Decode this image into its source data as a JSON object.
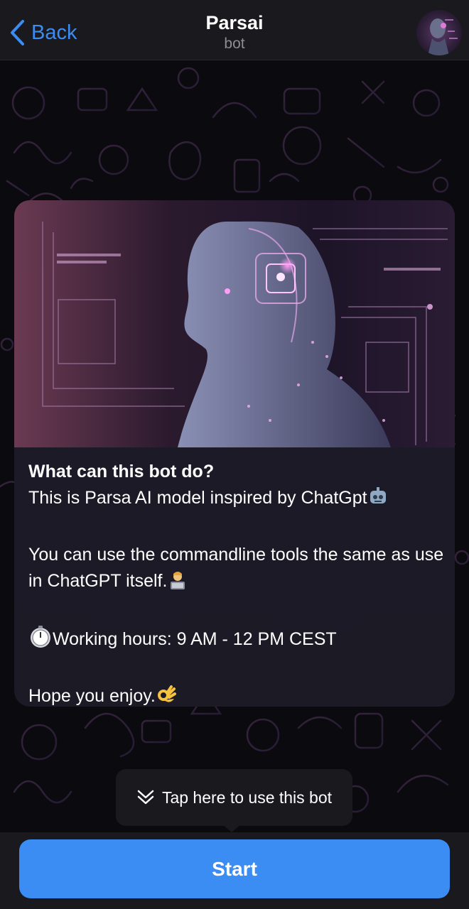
{
  "header": {
    "back_label": "Back",
    "title": "Parsai",
    "subtitle": "bot",
    "back_icon": "chevron-left-icon",
    "avatar_icon": "robot-avatar"
  },
  "card": {
    "title": "What can this bot do?",
    "line1": "This is Parsa AI model inspired by ChatGpt",
    "line2": "You can use the commandline tools the same as use in ChatGPT itself.",
    "line3": "Working hours: 9 AM - 12 PM CEST",
    "line4": "Hope you enjoy.",
    "emojis": [
      "robot-emoji",
      "technologist-emoji",
      "timer-clock-emoji",
      "ok-hand-emoji"
    ]
  },
  "tooltip": {
    "text": "Tap here to use this bot",
    "icon": "double-chevron-down-icon"
  },
  "start_button": {
    "label": "Start"
  },
  "colors": {
    "accent": "#3b8cf3",
    "header_bg": "#1a191e",
    "background": "#0b0a0e",
    "card_bg": "#1f1c29"
  }
}
